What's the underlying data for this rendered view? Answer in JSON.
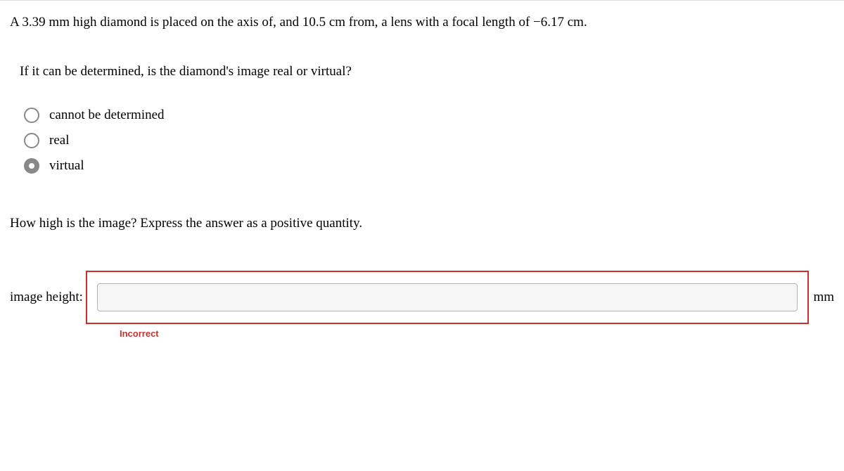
{
  "problem": {
    "statement": "A 3.39 mm high diamond is placed on the axis of, and 10.5 cm from, a lens with a focal length of −6.17 cm."
  },
  "question1": {
    "prompt": "If it can be determined, is the diamond's image real or virtual?",
    "options": [
      {
        "label": "cannot be determined",
        "selected": false
      },
      {
        "label": "real",
        "selected": false
      },
      {
        "label": "virtual",
        "selected": true
      }
    ]
  },
  "question2": {
    "prompt": "How high is the image? Express the answer as a positive quantity.",
    "label": "image height:",
    "value": "",
    "unit": "mm",
    "feedback": "Incorrect"
  }
}
